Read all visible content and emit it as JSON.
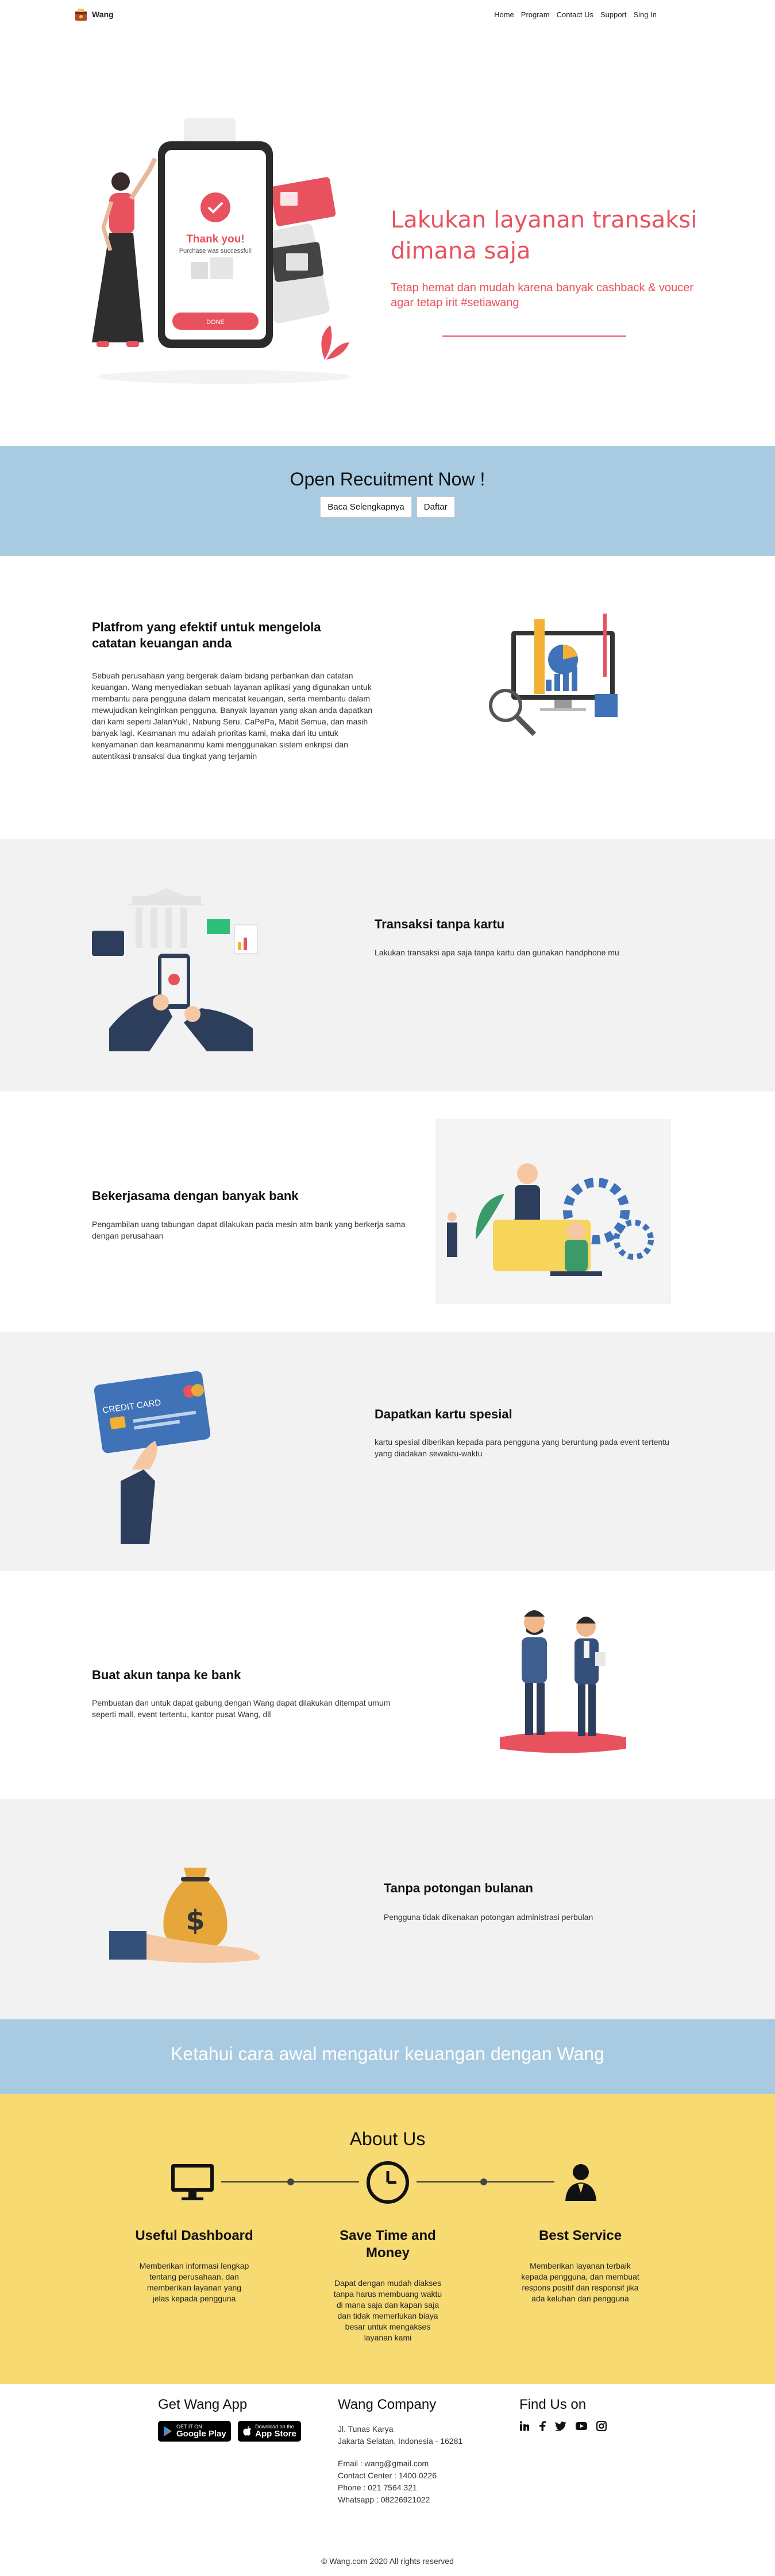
{
  "nav": {
    "brand": "Wang",
    "links": [
      "Home",
      "Program",
      "Contact Us",
      "Support",
      "Sing In"
    ]
  },
  "hero": {
    "title": "Lakukan layanan transaksi dimana saja",
    "subtitle": "Tetap hemat dan mudah karena banyak cashback & voucer agar tetap irit #setiawang",
    "phone": {
      "thank_you": "Thank you!",
      "message": "Purchase was successful!",
      "button": "DONE"
    }
  },
  "recruit": {
    "title": "Open Recuitment Now !",
    "read_more": "Baca Selengkapnya",
    "register": "Daftar"
  },
  "features": [
    {
      "title": "Platfrom yang efektif untuk mengelola catatan keuangan anda",
      "text": "Sebuah perusahaan yang bergerak dalam bidang perbankan dan catatan keuangan. Wang menyediakan sebuah layanan aplikasi yang digunakan untuk membantu para pengguna dalam mencatat keuangan, serta membantu dalam mewujudkan keinginkan pengguna. Banyak layanan yang akan anda dapatkan dari kami seperti JalanYuk!, Nabung Seru, CaPePa, Mabit Semua, dan masih banyak lagi. Keamanan mu adalah prioritas kami, maka dari itu untuk kenyamanan dan keamananmu kami menggunakan sistem enkripsi dan autentikasi transaksi dua tingkat yang terjamin"
    },
    {
      "title": "Transaksi tanpa kartu",
      "text": "Lakukan transaksi apa saja tanpa kartu dan gunakan handphone mu"
    },
    {
      "title": "Bekerjasama dengan banyak bank",
      "text": "Pengambilan uang tabungan dapat dilakukan pada mesin atm bank yang berkerja sama dengan perusahaan"
    },
    {
      "title": "Dapatkan kartu spesial",
      "text": "kartu spesial diberikan kepada para pengguna yang beruntung pada event tertentu yang diadakan sewaktu-waktu",
      "card_label": "CREDIT CARD"
    },
    {
      "title": "Buat akun tanpa ke bank",
      "text": "Pembuatan dan untuk dapat gabung dengan Wang dapat dilakukan ditempat umum seperti mall, event tertentu, kantor pusat Wang, dll"
    },
    {
      "title": "Tanpa potongan bulanan",
      "text": "Pengguna tidak dikenakan potongan administrasi perbulan"
    }
  ],
  "banner": {
    "text": "Ketahui cara awal mengatur keuangan dengan Wang"
  },
  "about": {
    "title": "About Us",
    "items": [
      {
        "icon": "monitor-icon",
        "title": "Useful Dashboard",
        "text": "Memberikan informasi lengkap tentang perusahaan, dan memberikan layanan yang jelas kepada pengguna"
      },
      {
        "icon": "clock-icon",
        "title": "Save Time and Money",
        "text": "Dapat dengan mudah diakses tanpa harus membuang waktu di mana saja dan kapan saja dan tidak memerlukan biaya besar untuk mengakses layanan kami"
      },
      {
        "icon": "user-icon",
        "title": "Best Service",
        "text": "Memberikan layanan terbaik kepada pengguna, dan membuat respons positif dan responsif jika ada keluhan dari pengguna"
      }
    ]
  },
  "footer": {
    "app": {
      "title": "Get Wang App",
      "google_small": "GET IT ON",
      "google_big": "Google Play",
      "apple_small": "Download on the",
      "apple_big": "App Store"
    },
    "company": {
      "title": "Wang Company",
      "address1": "Jl. Tunas Karya",
      "address2": "Jakarta Selatan, Indonesia - 16281",
      "email": "Email : wang@gmail.com",
      "contact": "Contact Center : 1400 0226",
      "phone": "Phone : 021 7564 321",
      "whatsapp": "Whatsapp : 08226921022"
    },
    "social": {
      "title": "Find Us on",
      "icons": [
        "linkedin-icon",
        "facebook-icon",
        "twitter-icon",
        "youtube-icon",
        "instagram-icon"
      ]
    },
    "copyright": "© Wang.com 2020 All rights reserved"
  },
  "colors": {
    "accent": "#e8525e",
    "light_blue": "#a8cbe1",
    "yellow": "#f7da72",
    "grey": "#f2f2f2",
    "navy": "#2c3e5c"
  }
}
